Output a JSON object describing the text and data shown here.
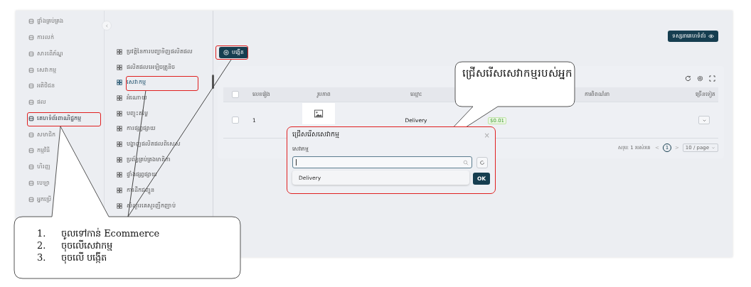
{
  "sidebar": {
    "items": [
      {
        "label": "ផ្ទាំងគ្រប់គ្រង",
        "selected": false
      },
      {
        "label": "ការលក់",
        "selected": false
      },
      {
        "label": "សារពើភ័ណ្ឌ",
        "selected": false
      },
      {
        "label": "សេវាកម្ម",
        "selected": false
      },
      {
        "label": "អតិថិជន",
        "selected": false
      },
      {
        "label": "ផល",
        "selected": false
      },
      {
        "label": "គេហទំព័រពាណិជ្ជកម្ម",
        "selected": true
      },
      {
        "label": "សមាជិក",
        "selected": false
      },
      {
        "label": "កម្មវិធី",
        "selected": false
      },
      {
        "label": "ហិរញ្ញ",
        "selected": false
      },
      {
        "label": "បេឡា",
        "selected": false
      },
      {
        "label": "អ្នកប្រើ",
        "selected": false
      }
    ]
  },
  "submenu": {
    "items": [
      {
        "label": "ប្រវត្តិនៃការបញ្ជាទិញផលិតផល",
        "selected": false
      },
      {
        "label": "ផលិតផលអេឡិចត្រូនិច",
        "selected": false
      },
      {
        "label": "សេវាកម្ម",
        "selected": true
      },
      {
        "label": "អំណោយ",
        "selected": false
      },
      {
        "label": "បញ្ចុះតម្លៃ",
        "selected": false
      },
      {
        "label": "ការផ្សព្វផ្សាយ",
        "selected": false
      },
      {
        "label": "បង្ហាញផលិតផលពិសេស",
        "selected": false
      },
      {
        "label": "ប្រព័ន្ធគ្រប់គ្រងមាតិកា",
        "selected": false
      },
      {
        "label": "ផ្ទាំងផ្សព្វផ្សាយ",
        "selected": false
      },
      {
        "label": "ការដឹកជញ្ជូន",
        "selected": false
      },
      {
        "label": "សំណួរគេសួរញឹកញាប់",
        "selected": false
      }
    ]
  },
  "visit_button": "ទស្សនាគេហទំព័រ",
  "create_button": "បង្កើត",
  "table": {
    "all_checked": false,
    "columns": [
      "លេខរៀង",
      "រូបភាព",
      "ឈ្មោះ",
      "ការពិពណ៌នា",
      "ច្រើនទៀត"
    ],
    "rows": [
      {
        "number": "1",
        "name": "Delivery",
        "price": "$0.01",
        "checked": false
      }
    ],
    "pagination": {
      "total": "សរុប: 1 របស់របរ",
      "prev": "<",
      "page": "1",
      "next": ">",
      "page_size": "10 / page"
    }
  },
  "dialog": {
    "title": "ជ្រើសរើសសេវាកម្ម",
    "close": "×",
    "field_label": "សេវាកម្ម",
    "options": [
      {
        "label": "Delivery"
      }
    ],
    "ok": "OK"
  },
  "callouts": {
    "tip": "ជ្រើសរើសសេវាកម្មរបស់អ្នក",
    "steps": [
      {
        "number": "1.",
        "text": "ចូលទៅកាន់ Ecommerce"
      },
      {
        "number": "2.",
        "text": "ចុចលើសេវាកម្ម"
      },
      {
        "number": "3.",
        "text": "ចុចលើ បង្កើត"
      }
    ]
  }
}
